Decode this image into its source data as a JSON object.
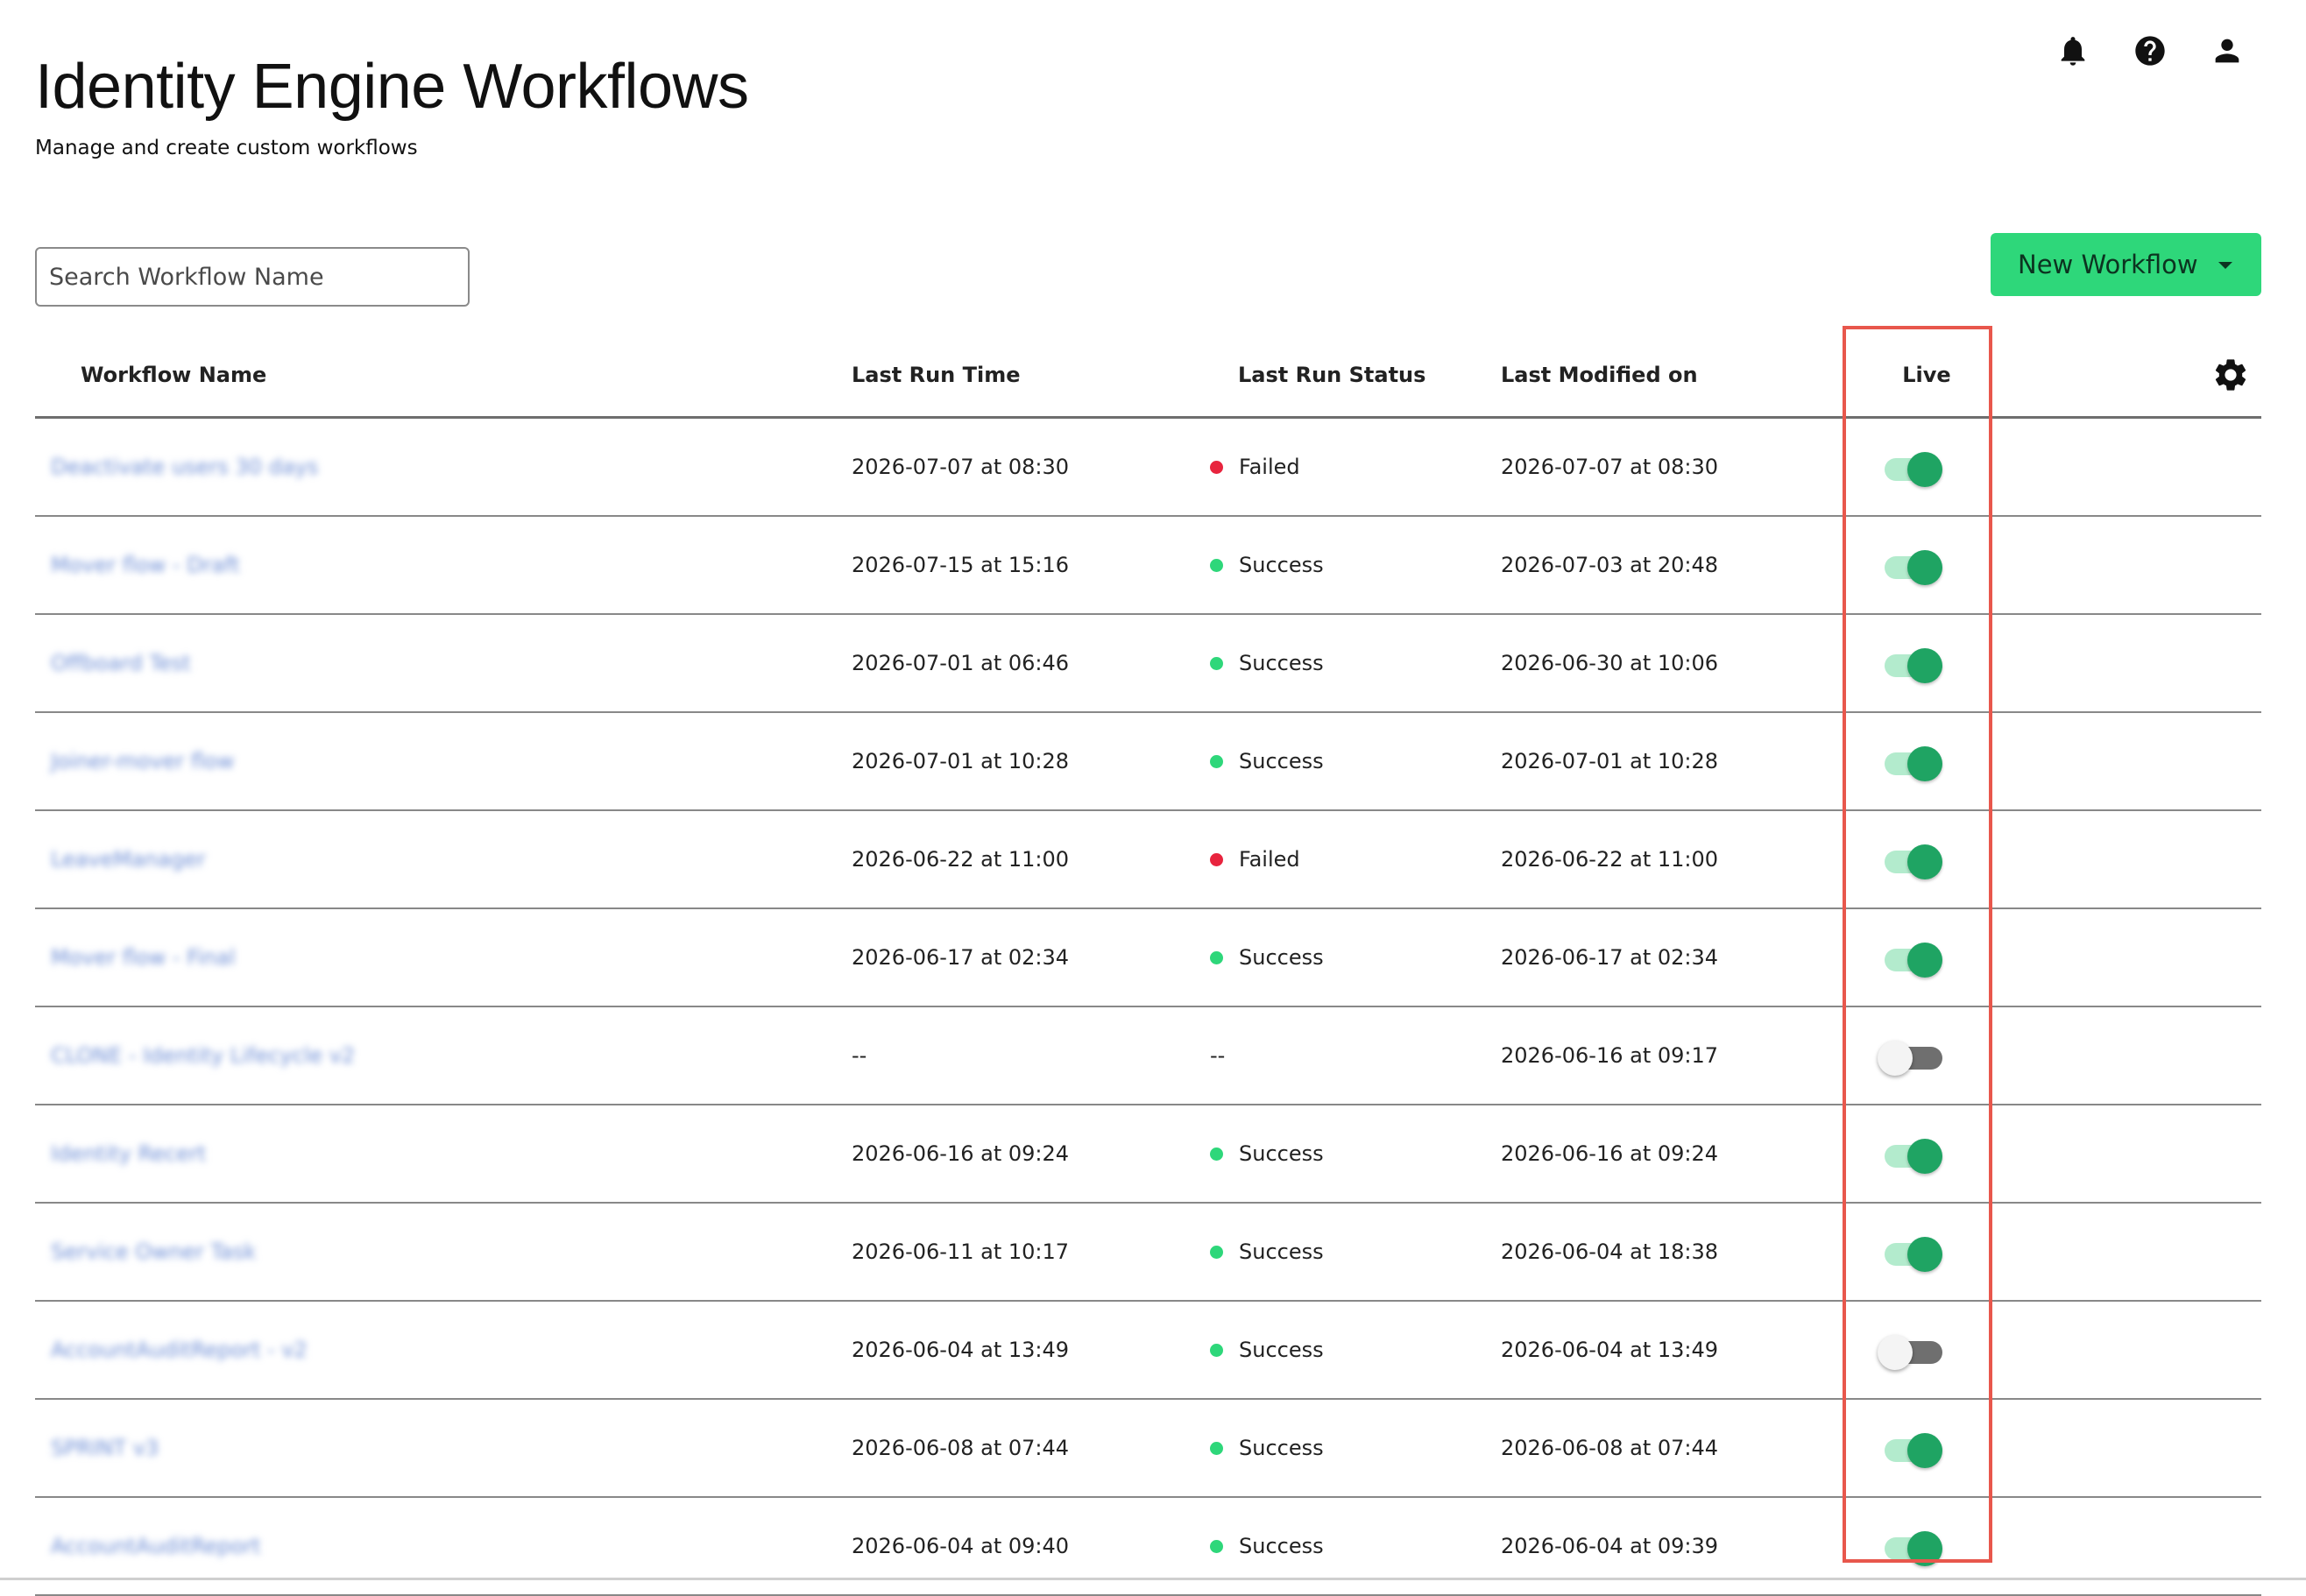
{
  "header": {
    "title": "Identity Engine Workflows",
    "subtitle": "Manage and create custom workflows",
    "icons": [
      "bell-icon",
      "help-icon",
      "user-icon"
    ]
  },
  "search": {
    "placeholder": "Search Workflow Name",
    "value": ""
  },
  "new_workflow_button": {
    "label": "New Workflow"
  },
  "colors": {
    "accent": "#2ed77a",
    "toggle_on": "#1fa463",
    "success": "#2ed77a",
    "failed": "#e8243e",
    "highlight": "#e8574c"
  },
  "table": {
    "headers": {
      "name": "Workflow Name",
      "run_time": "Last Run Time",
      "run_status": "Last Run Status",
      "modified": "Last Modified on",
      "live": "Live"
    },
    "rows": [
      {
        "name": "Deactivate users 30 days",
        "run_time": "2026-07-07 at 08:30",
        "status": "Failed",
        "modified": "2026-07-07 at 08:30",
        "live": true
      },
      {
        "name": "Mover flow - Draft",
        "run_time": "2026-07-15 at 15:16",
        "status": "Success",
        "modified": "2026-07-03 at 20:48",
        "live": true
      },
      {
        "name": "Offboard Test",
        "run_time": "2026-07-01 at 06:46",
        "status": "Success",
        "modified": "2026-06-30 at 10:06",
        "live": true
      },
      {
        "name": "Joiner-mover flow",
        "run_time": "2026-07-01 at 10:28",
        "status": "Success",
        "modified": "2026-07-01 at 10:28",
        "live": true
      },
      {
        "name": "LeaveManager",
        "run_time": "2026-06-22 at 11:00",
        "status": "Failed",
        "modified": "2026-06-22 at 11:00",
        "live": true
      },
      {
        "name": "Mover flow - Final",
        "run_time": "2026-06-17 at 02:34",
        "status": "Success",
        "modified": "2026-06-17 at 02:34",
        "live": true
      },
      {
        "name": "CLONE - Identity Lifecycle v2",
        "run_time": "--",
        "status": "--",
        "modified": "2026-06-16 at 09:17",
        "live": false
      },
      {
        "name": "Identity Recert",
        "run_time": "2026-06-16 at 09:24",
        "status": "Success",
        "modified": "2026-06-16 at 09:24",
        "live": true
      },
      {
        "name": "Service Owner Task",
        "run_time": "2026-06-11 at 10:17",
        "status": "Success",
        "modified": "2026-06-04 at 18:38",
        "live": true
      },
      {
        "name": "AccountAuditReport - v2",
        "run_time": "2026-06-04 at 13:49",
        "status": "Success",
        "modified": "2026-06-04 at 13:49",
        "live": false
      },
      {
        "name": "SPRINT v3",
        "run_time": "2026-06-08 at 07:44",
        "status": "Success",
        "modified": "2026-06-08 at 07:44",
        "live": true
      },
      {
        "name": "AccountAuditReport",
        "run_time": "2026-06-04 at 09:40",
        "status": "Success",
        "modified": "2026-06-04 at 09:39",
        "live": true
      }
    ]
  }
}
